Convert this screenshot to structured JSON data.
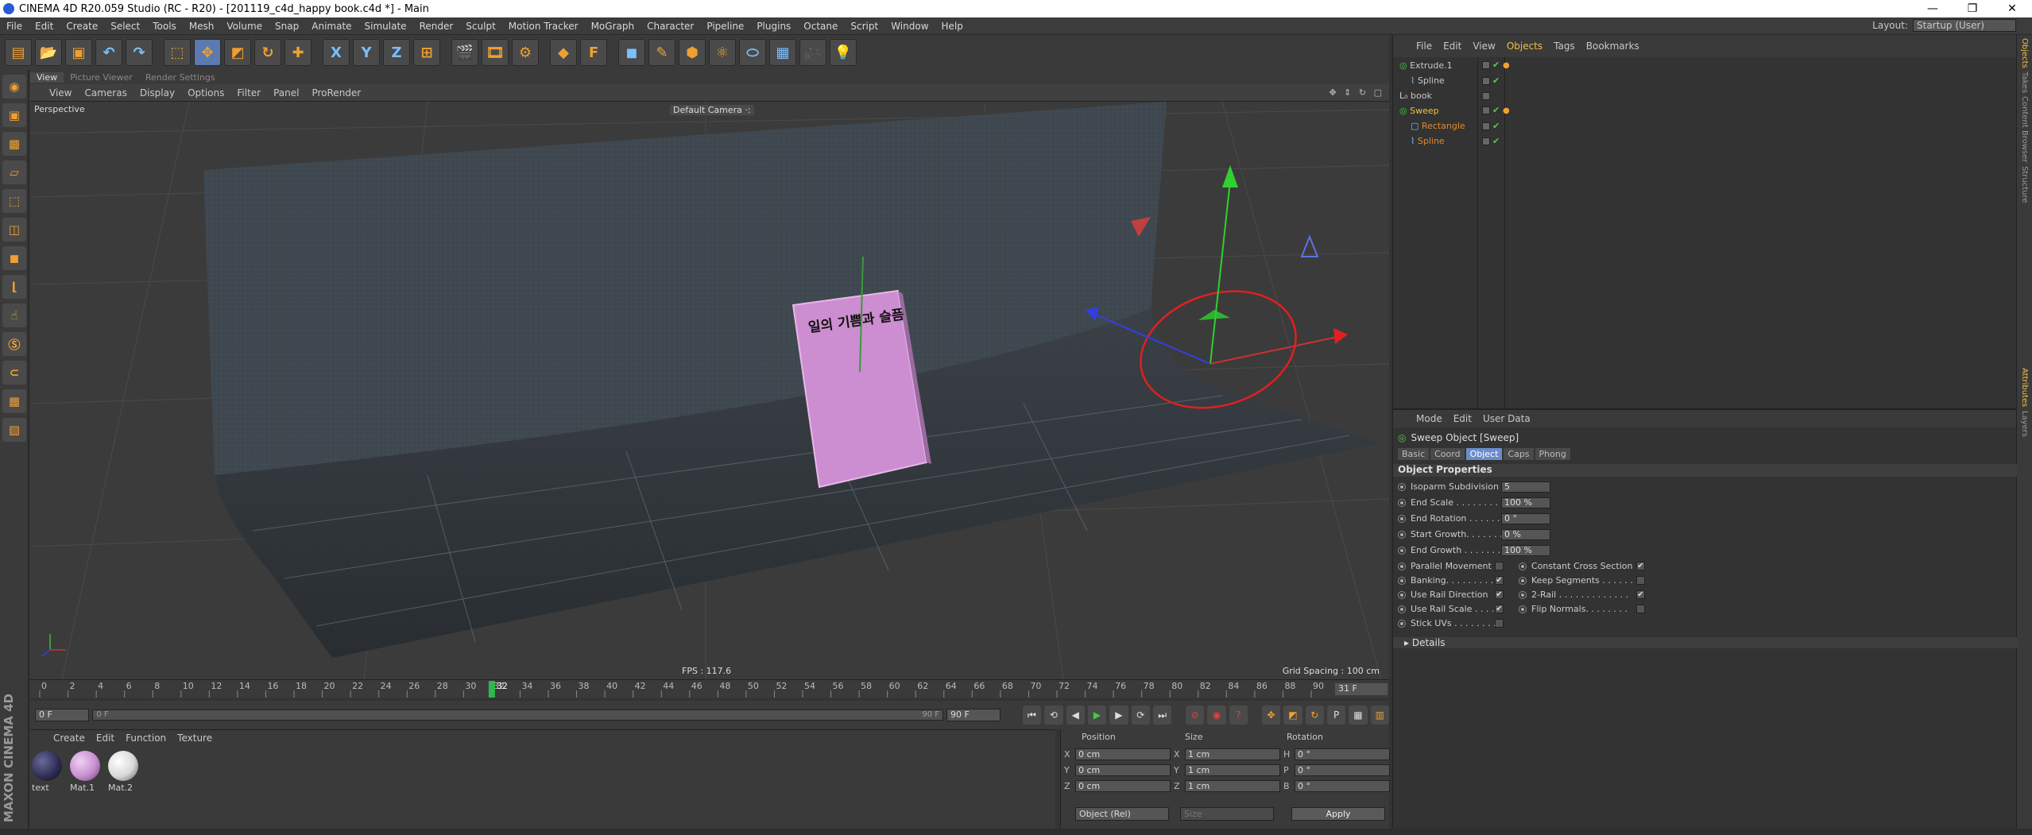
{
  "window": {
    "title": "CINEMA 4D R20.059 Studio (RC - R20) - [201119_c4d_happy book.c4d *] - Main",
    "minimize": "—",
    "restore": "❐",
    "close": "✕"
  },
  "menubar": {
    "items": [
      "File",
      "Edit",
      "Create",
      "Select",
      "Tools",
      "Mesh",
      "Volume",
      "Snap",
      "Animate",
      "Simulate",
      "Render",
      "Sculpt",
      "Motion Tracker",
      "MoGraph",
      "Character",
      "Pipeline",
      "Plugins",
      "Octane",
      "Script",
      "Window",
      "Help"
    ],
    "layout_label": "Layout:",
    "layout_value": "Startup (User)"
  },
  "toolbar": {
    "x_label": "X",
    "y_label": "Y",
    "z_label": "Z",
    "f_label": "F"
  },
  "viewport_tabs": [
    "View",
    "Picture Viewer",
    "Render Settings"
  ],
  "viewport_menu": [
    "View",
    "Cameras",
    "Display",
    "Options",
    "Filter",
    "Panel",
    "ProRender"
  ],
  "viewport": {
    "perspective": "Perspective",
    "camera": "Default Camera ·:",
    "fps": "FPS : 117.6",
    "grid_spacing": "Grid Spacing : 100 cm",
    "book_text": "일의 기쁨과 슬픔"
  },
  "timeline": {
    "ticks": [
      0,
      2,
      4,
      6,
      8,
      10,
      12,
      14,
      16,
      18,
      20,
      22,
      24,
      26,
      28,
      30,
      32,
      34,
      36,
      38,
      40,
      42,
      44,
      46,
      48,
      50,
      52,
      54,
      56,
      58,
      60,
      62,
      64,
      66,
      68,
      70,
      72,
      74,
      76,
      78,
      80,
      82,
      84,
      86,
      88,
      90
    ],
    "max_frame": 90,
    "current_frame": 32,
    "current_label": "32",
    "end_field": "31 F"
  },
  "transport": {
    "start_field": "0 F",
    "scrub_start": "0 F",
    "scrub_end": "90 F",
    "end_field": "90 F"
  },
  "material_manager": {
    "menu": [
      "Create",
      "Edit",
      "Function",
      "Texture"
    ],
    "materials": [
      {
        "name": "text",
        "color": "#2a2a50"
      },
      {
        "name": "Mat.1",
        "color": "#c68fd0"
      },
      {
        "name": "Mat.2",
        "color": "#d8d8d8"
      }
    ],
    "maxon_text": "MAXON CINEMA 4D"
  },
  "coordinates": {
    "headers": {
      "position": "Position",
      "size": "Size",
      "rotation": "Rotation"
    },
    "rows": [
      {
        "axis": "X",
        "pos": "0 cm",
        "size": "1 cm",
        "rot_axis": "H",
        "rot": "0 °"
      },
      {
        "axis": "Y",
        "pos": "0 cm",
        "size": "1 cm",
        "rot_axis": "P",
        "rot": "0 °"
      },
      {
        "axis": "Z",
        "pos": "0 cm",
        "size": "1 cm",
        "rot_axis": "B",
        "rot": "0 °"
      }
    ],
    "mode": "Object (Rel)",
    "size_mode": "Size",
    "apply": "Apply"
  },
  "object_manager": {
    "menu": [
      "File",
      "Edit",
      "View",
      "Objects",
      "Tags",
      "Bookmarks"
    ],
    "objects": [
      {
        "name": "Extrude.1",
        "indent": 0,
        "color": "#c8c8c8"
      },
      {
        "name": "Spline",
        "indent": 1,
        "color": "#c8c8c8"
      },
      {
        "name": "book",
        "indent": 0,
        "color": "#c8c8c8"
      },
      {
        "name": "Sweep",
        "indent": 0,
        "color": "#f0c040"
      },
      {
        "name": "Rectangle",
        "indent": 1,
        "color": "#e08a2a"
      },
      {
        "name": "Spline",
        "indent": 1,
        "color": "#e08a2a"
      }
    ]
  },
  "right_strip": [
    "Objects",
    "Takes",
    "Content Browser",
    "Structure"
  ],
  "right_strip_lower": [
    "Attributes",
    "Layers"
  ],
  "attributes": {
    "menu": [
      "Mode",
      "Edit",
      "User Data"
    ],
    "title": "Sweep Object [Sweep]",
    "tabs": [
      "Basic",
      "Coord",
      "Object",
      "Caps",
      "Phong"
    ],
    "active_tab": "Object",
    "section": "Object Properties",
    "fields": [
      {
        "label": "Isoparm Subdivision",
        "value": "5"
      },
      {
        "label": "End Scale . . . . . . . . .",
        "value": "100 %"
      },
      {
        "label": "End Rotation . . . . . .",
        "value": "0 °"
      },
      {
        "label": "Start Growth. . . . . . .",
        "value": "0 %"
      },
      {
        "label": "End Growth . . . . . . .",
        "value": "100 %"
      }
    ],
    "checks_left": [
      {
        "label": "Parallel Movement",
        "checked": false
      },
      {
        "label": "Banking. . . . . . . . . . .",
        "checked": true
      },
      {
        "label": "Use Rail Direction",
        "checked": true
      },
      {
        "label": "Use Rail Scale . . . .",
        "checked": true
      },
      {
        "label": "Stick UVs . . . . . . . .",
        "checked": false
      }
    ],
    "checks_right": [
      {
        "label": "Constant Cross Section",
        "checked": true
      },
      {
        "label": "Keep Segments . . . . . .",
        "checked": false
      },
      {
        "label": "2-Rail . . . . . . . . . . . . .",
        "checked": true
      },
      {
        "label": "Flip Normals. . . . . . . .",
        "checked": false
      }
    ],
    "details": "Details"
  }
}
